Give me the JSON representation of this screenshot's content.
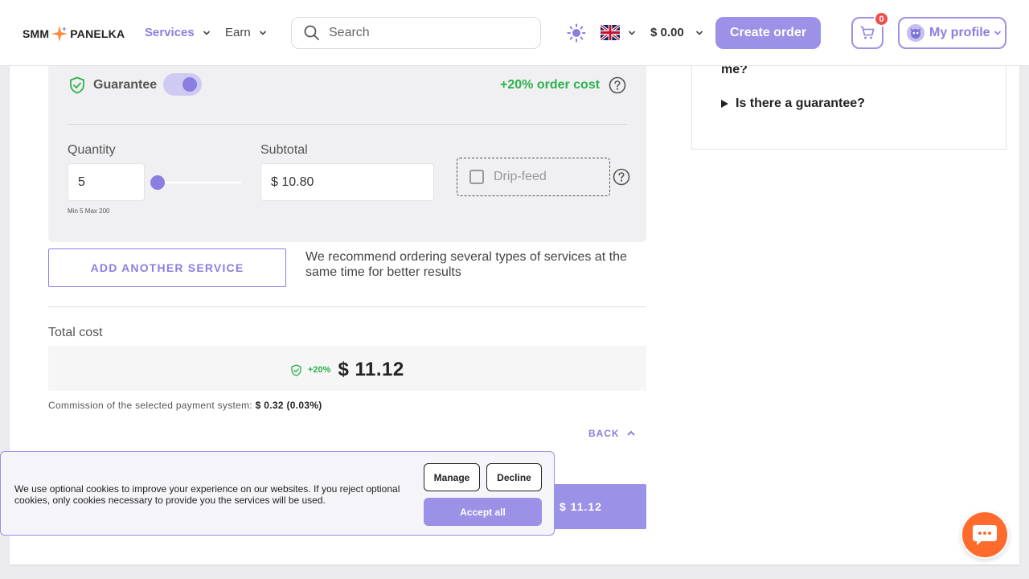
{
  "header": {
    "logo_left": "SMM",
    "logo_right": "PANELKA",
    "nav": [
      {
        "label": "Services"
      },
      {
        "label": "Earn"
      }
    ],
    "search_placeholder": "Search",
    "balance": "$ 0.00",
    "create_order": "Create order",
    "cart_count": "0",
    "profile": "My profile"
  },
  "order": {
    "guarantee_label": "Guarantee",
    "guarantee_on": true,
    "guarantee_cost": "+20% order cost",
    "quantity_label": "Quantity",
    "quantity_value": "5",
    "quantity_min_max": "Min 5 Max 200",
    "quantity_slider_fraction": 0.0,
    "subtotal_label": "Subtotal",
    "subtotal_value": "$ 10.80",
    "drip_feed_label": "Drip-feed",
    "add_service": "ADD ANOTHER SERVICE",
    "recommend_text": "We recommend ordering several types of services at the same time for better results",
    "total_label": "Total cost",
    "total_pct": "+20%",
    "total_amount": "$ 11.12",
    "commission_prefix": "Commission of the selected payment system:",
    "commission_value": "$ 0.32 (0.03%)",
    "back": "BACK",
    "pay_button": "$ 11.12"
  },
  "faq": {
    "prev_tail": "me?",
    "item": "Is there a guarantee?"
  },
  "cookie": {
    "text": "We use optional cookies to improve your experience on our websites. If you reject optional cookies, only cookies necessary to provide you the services will be used.",
    "manage": "Manage",
    "decline": "Decline",
    "accept": "Accept all"
  },
  "colors": {
    "accent": "#9b91e6",
    "accent_text": "#8a7fe0",
    "success": "#2bb24c",
    "chat": "#ff6b2c",
    "badge": "#f24d4d"
  }
}
